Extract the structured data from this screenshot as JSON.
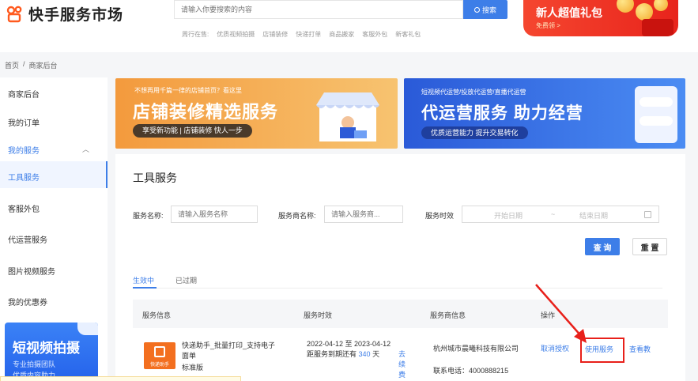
{
  "header": {
    "logo_text": "快手服务市场",
    "search_placeholder": "请输入你要搜索的内容",
    "search_button": "搜索",
    "hot_label": "周行在售:",
    "hot_links": [
      "优质视频拍摄",
      "店铺装修",
      "快递打单",
      "商品搬家",
      "客服外包",
      "新客礼包"
    ],
    "promo_title": "新人超值礼包",
    "promo_sub": "免费领 >"
  },
  "breadcrumb": [
    "首页",
    "/",
    "商家后台"
  ],
  "sidebar": {
    "items": [
      "商家后台",
      "我的订单",
      "我的服务",
      "工具服务",
      "客服外包",
      "代运营服务",
      "图片视频服务",
      "我的优惠券"
    ],
    "banner_title": "短视频拍摄",
    "banner_line1": "专业拍摄团队",
    "banner_line2": "优质内容助力"
  },
  "banners": {
    "left_top": "不想再用千篇一律的店铺首页？看这里",
    "left_title": "店铺装修精选服务",
    "left_pill": "享受新功能 | 店铺装修 快人一步",
    "right_top": "短视频代运营/投放代运营/直播代运营",
    "right_title": "代运营服务 助力经营",
    "right_pill": "优质运营能力 提升交易转化"
  },
  "panel": {
    "title": "工具服务",
    "filters": {
      "service_name_label": "服务名称:",
      "service_name_placeholder": "请输入服务名称",
      "provider_label": "服务商名称:",
      "provider_placeholder": "请输入服务商...",
      "period_label": "服务时效",
      "start_placeholder": "开始日期",
      "range_sep": "~",
      "end_placeholder": "结束日期"
    },
    "query_button": "查 询",
    "reset_button": "重 置",
    "tabs": [
      "生效中",
      "已过期"
    ],
    "table": {
      "headers": [
        "服务信息",
        "服务时效",
        "服务商信息",
        "操作"
      ],
      "row": {
        "logo_text": "快递助手",
        "service_name": "快递助手_批量打印_支持电子面单",
        "edition": "标准版",
        "period": "2022-04-12 至 2023-04-12",
        "remain_prefix": "距服务到期还有",
        "remain_days": "340",
        "remain_unit": "天",
        "renew_link": "去续费",
        "provider": "杭州城市晨曦科技有限公司",
        "phone_label": "联系电话：",
        "phone": "4000888215",
        "cancel_auth": "取消授权",
        "use_service": "使用服务",
        "view_tutorial": "查看教"
      }
    }
  }
}
